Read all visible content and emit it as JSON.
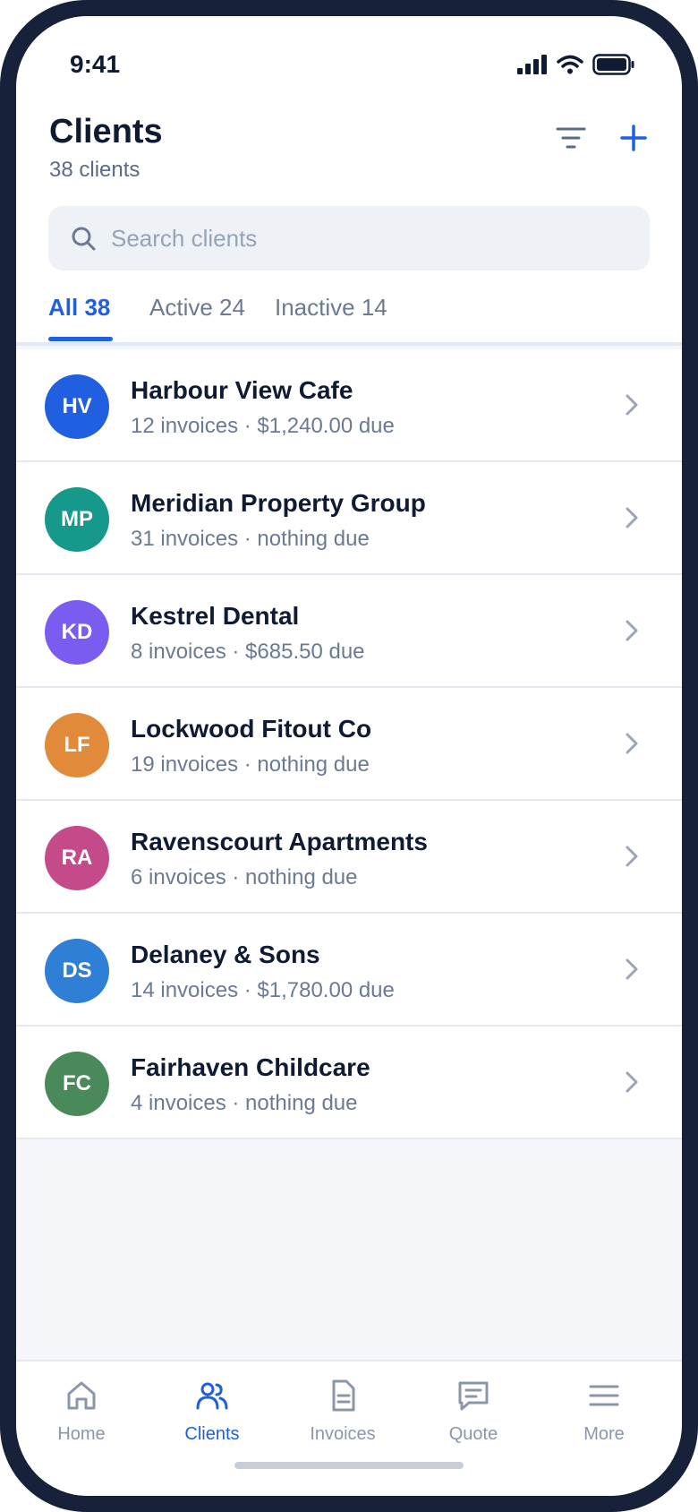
{
  "status_bar": {
    "time": "9:41"
  },
  "header": {
    "title": "Clients",
    "subtitle": "38 clients"
  },
  "search": {
    "placeholder": "Search clients"
  },
  "tabs": [
    {
      "label": "All 38",
      "active": true
    },
    {
      "label": "Active 24",
      "active": false
    },
    {
      "label": "Inactive 14",
      "active": false
    }
  ],
  "clients": [
    {
      "initials": "HV",
      "name": "Harbour View Cafe",
      "meta": "12 invoices · $1,240.00 due",
      "color": "#1f5fe0"
    },
    {
      "initials": "MP",
      "name": "Meridian Property Group",
      "meta": "31 invoices · nothing due",
      "color": "#16998a"
    },
    {
      "initials": "KD",
      "name": "Kestrel Dental",
      "meta": "8 invoices · $685.50 due",
      "color": "#7a5cf0"
    },
    {
      "initials": "LF",
      "name": "Lockwood Fitout Co",
      "meta": "19 invoices · nothing due",
      "color": "#e08a3a"
    },
    {
      "initials": "RA",
      "name": "Ravenscourt Apartments",
      "meta": "6 invoices · nothing due",
      "color": "#c44a8a"
    },
    {
      "initials": "DS",
      "name": "Delaney & Sons",
      "meta": "14 invoices · $1,780.00 due",
      "color": "#2f7fd6"
    },
    {
      "initials": "FC",
      "name": "Fairhaven Childcare",
      "meta": "4 invoices · nothing due",
      "color": "#4a8a5a"
    }
  ],
  "nav": [
    {
      "label": "Home",
      "icon": "home-icon",
      "active": false
    },
    {
      "label": "Clients",
      "icon": "users-icon",
      "active": true
    },
    {
      "label": "Invoices",
      "icon": "document-icon",
      "active": false
    },
    {
      "label": "Quote",
      "icon": "chat-icon",
      "active": false
    },
    {
      "label": "More",
      "icon": "menu-icon",
      "active": false
    }
  ],
  "colors": {
    "accent": "#1f5fe0",
    "text_primary": "#0f1b33",
    "text_secondary": "#6b7a93",
    "frame": "#17213a"
  }
}
